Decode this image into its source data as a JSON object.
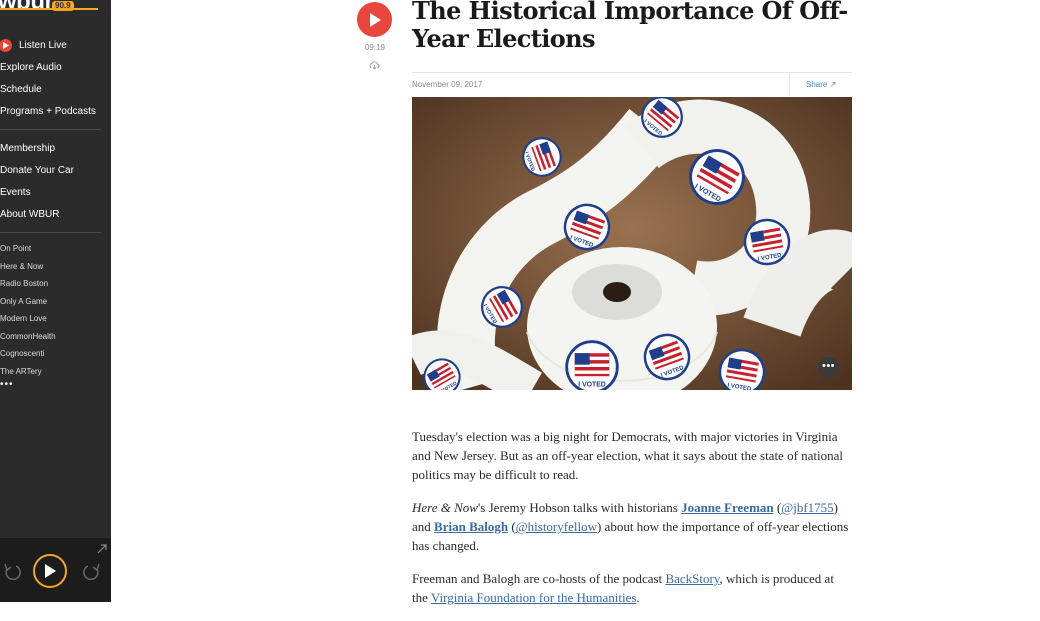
{
  "sidebar": {
    "logo": "wbur",
    "logo_badge": "90.9",
    "primary_nav": [
      "Listen Live",
      "Explore Audio",
      "Schedule",
      "Programs + Podcasts"
    ],
    "secondary_nav": [
      "Membership",
      "Donate Your Car",
      "Events",
      "About WBUR"
    ],
    "shows": [
      "On Point",
      "Here & Now",
      "Radio Boston",
      "Only A Game",
      "Modern Love",
      "CommonHealth",
      "Cognoscenti",
      "The ARTery"
    ],
    "more": "•••"
  },
  "article": {
    "duration": "09:19",
    "title": "The Historical Importance Of Off-Year Elections",
    "date": "November 09, 2017",
    "share": "Share ↗",
    "p1": "Tuesday's election was a big night for Democrats, with major victories in Virginia and New Jersey. But as an off-year election, what it says about the state of national politics may be difficult to read.",
    "p2": {
      "show": "Here & Now",
      "t1": "'s Jeremy Hobson talks with historians ",
      "name1": "Joanne Freeman",
      "t2": " (",
      "handle1": "@jbf1755",
      "t3": ") and ",
      "name2": "Brian Balogh",
      "t4": " (",
      "handle2": "@historyfellow",
      "t5": ") about how the importance of off-year elections has changed."
    },
    "p3": {
      "t1": "Freeman and Balogh are co-hosts of the podcast ",
      "link1": "BackStory",
      "t2": ", which is produced at the ",
      "link2": "Virginia Foundation for the Humanities",
      "t3": "."
    }
  },
  "colors": {
    "sidebar_bg": "#2b2b2b",
    "accent_orange": "#f5a623",
    "play_red": "#e8453c",
    "link_blue": "#3b6aa0"
  },
  "icons": [
    "play-icon",
    "download-icon",
    "share-arrow-icon",
    "more-icon",
    "rewind-icon",
    "forward-icon",
    "expand-icon"
  ]
}
